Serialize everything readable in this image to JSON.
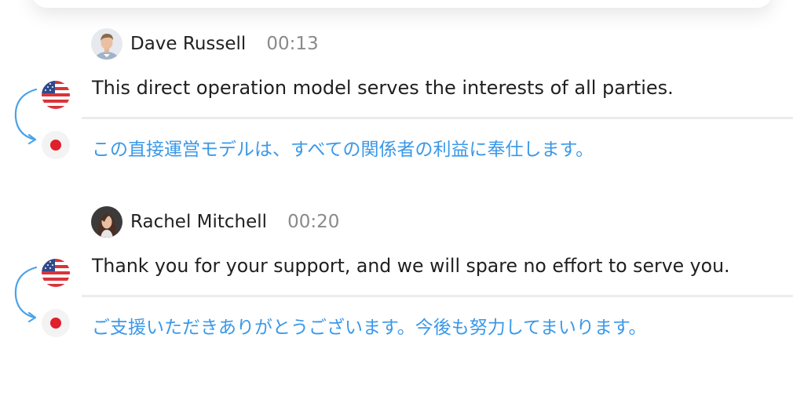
{
  "colors": {
    "source_text": "#1f1f1f",
    "translation_text": "#3a98e8",
    "timestamp": "#8a8a8a",
    "arrow": "#4aa3e8",
    "divider": "#ececec"
  },
  "transcript": [
    {
      "speaker": "Dave Russell",
      "time": "00:13",
      "avatar_icon": "man-avatar",
      "source_flag_icon": "us-flag-icon",
      "target_flag_icon": "japan-flag-icon",
      "source_text": "This direct operation model serves the interests of all parties.",
      "translated_text": "この直接運営モデルは、すべての関係者の利益に奉仕します。"
    },
    {
      "speaker": "Rachel Mitchell",
      "time": "00:20",
      "avatar_icon": "woman-avatar",
      "source_flag_icon": "us-flag-icon",
      "target_flag_icon": "japan-flag-icon",
      "source_text": "Thank you for your support, and we will spare no effort to serve you.",
      "translated_text": "ご支援いただきありがとうございます。今後も努力してまいります。"
    }
  ]
}
